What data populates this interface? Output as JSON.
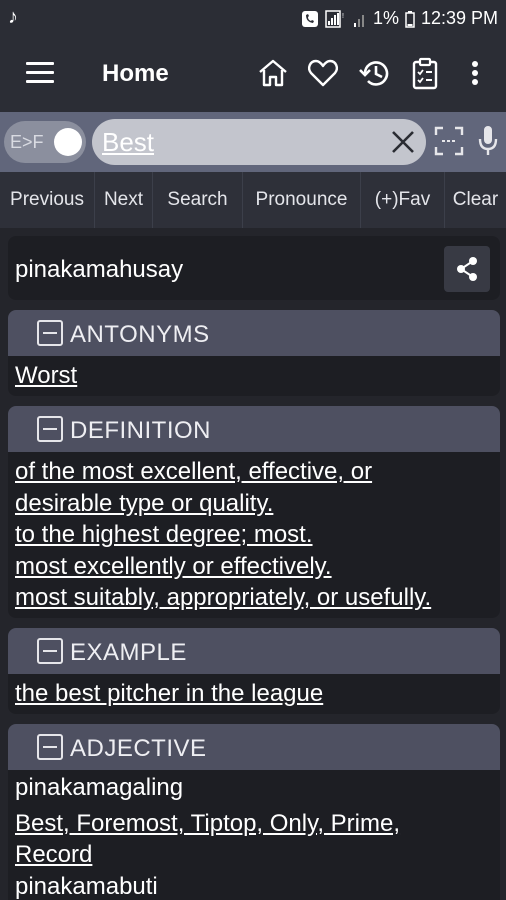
{
  "status_bar": {
    "battery": "1%",
    "time": "12:39 PM"
  },
  "app_bar": {
    "title": "Home",
    "icons": [
      "home-icon",
      "heart-icon",
      "history-icon",
      "clipboard-icon",
      "more-vert-icon"
    ]
  },
  "search": {
    "mode_label": "E>F",
    "query": "Best"
  },
  "actions": [
    "Previous",
    "Next",
    "Search",
    "Pronounce",
    "(+)Fav",
    "Clear"
  ],
  "result": {
    "word": "pinakamahusay",
    "sections": {
      "antonyms": {
        "title": "ANTONYMS",
        "text": "Worst"
      },
      "definition": {
        "title": "DEFINITION",
        "lines": [
          "of the most excellent, effective, or",
          "desirable type or quality.",
          "to the highest degree; most.",
          "most excellently or effectively.",
          "most suitably, appropriately, or usefully."
        ]
      },
      "example": {
        "title": "EXAMPLE",
        "text": "the best pitcher in the league"
      },
      "adjective": {
        "title": "ADJECTIVE",
        "entry1_word": "pinakamagaling",
        "entry1_syn_line1": "Best, Foremost, Tiptop, Only, Prime,",
        "entry1_syn_line2": "Record",
        "entry2_word": "pinakamabuti"
      }
    }
  }
}
